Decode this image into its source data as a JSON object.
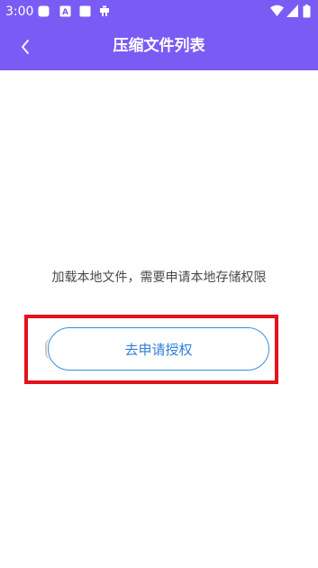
{
  "status_bar": {
    "time": "3:00",
    "icons": [
      "app-icon",
      "font-icon",
      "square-icon",
      "bug-icon"
    ],
    "right_icons": [
      "wifi-icon",
      "signal-icon",
      "battery-icon"
    ]
  },
  "app_bar": {
    "title": "压缩文件列表",
    "back_icon": "chevron-left-icon",
    "background_color": "#7a5cf5"
  },
  "content": {
    "message": "加载本地文件，需要申请本地存储权限",
    "grant_button_label": "去申请授权",
    "highlight_color": "#e3121c",
    "button_color": "#2f7fd8"
  }
}
